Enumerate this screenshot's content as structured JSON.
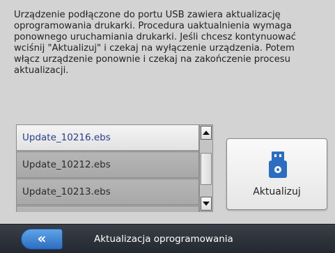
{
  "message": {
    "text": "Urządzenie podłączone do portu USB zawiera aktualizację\noprogramowania drukarki. Procedura uaktualnienia wymaga\nponownego uruchamiania drukarki. Jeśli chcesz kontynuować\nwciśnij \"Aktualizuj\" i czekaj na wyłączenie urządzenia. Potem\nwłącz urządzenie ponownie i czekaj na zakończenie procesu\naktualizacji."
  },
  "files": {
    "items": [
      {
        "label": "Update_10216.ebs",
        "selected": true
      },
      {
        "label": "Update_10212.ebs",
        "selected": false
      },
      {
        "label": "Update_10213.ebs",
        "selected": false
      }
    ]
  },
  "scrollbar": {
    "up_icon": "arrow-up-icon",
    "down_icon": "arrow-down-icon"
  },
  "update_button": {
    "label": "Aktualizuj",
    "icon": "usb-drive-icon"
  },
  "bottom_bar": {
    "back_label": "«",
    "title": "Aktualizacja oprogramowania"
  },
  "colors": {
    "accent": "#2d6dbf",
    "selected_text": "#2a3e8c",
    "bar_background": "#2c3038"
  }
}
